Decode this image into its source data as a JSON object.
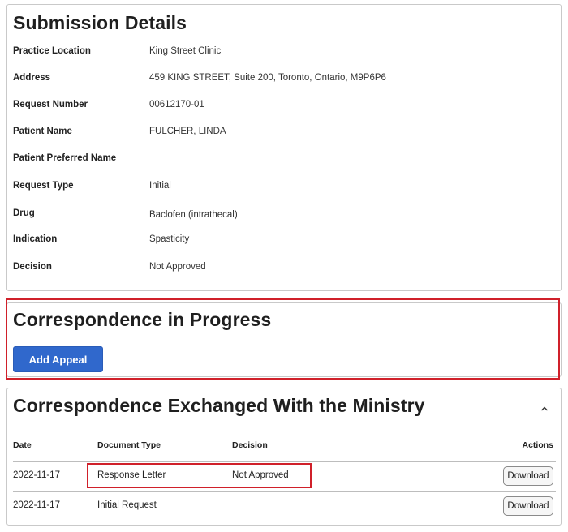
{
  "submission_details": {
    "title": "Submission Details",
    "rows": [
      {
        "label": "Practice Location",
        "value": "King Street Clinic"
      },
      {
        "label": "Address",
        "value": "459 KING STREET, Suite 200, Toronto, Ontario, M9P6P6"
      },
      {
        "label": "Request Number",
        "value": "00612170-01"
      },
      {
        "label": "Patient Name",
        "value": "FULCHER, LINDA"
      },
      {
        "label": "Patient Preferred Name",
        "value": ""
      },
      {
        "label": "Request Type",
        "value": "Initial"
      },
      {
        "label": "Drug",
        "value": "Baclofen (intrathecal)"
      },
      {
        "label": "Indication",
        "value": "Spasticity"
      },
      {
        "label": "Decision",
        "value": "Not Approved"
      }
    ]
  },
  "correspondence_in_progress": {
    "title": "Correspondence in Progress",
    "add_appeal_label": "Add Appeal"
  },
  "correspondence_exchanged": {
    "title": "Correspondence Exchanged With the Ministry",
    "collapse_icon": "chevron-up-icon",
    "columns": {
      "date": "Date",
      "document_type": "Document Type",
      "decision": "Decision",
      "actions": "Actions"
    },
    "rows": [
      {
        "date": "2022-11-17",
        "document_type": "Response Letter",
        "decision": "Not Approved",
        "action_label": "Download"
      },
      {
        "date": "2022-11-17",
        "document_type": "Initial Request",
        "decision": "",
        "action_label": "Download"
      }
    ]
  },
  "colors": {
    "primary_button": "#3068cc",
    "highlight": "#d0202a",
    "border": "#c9c9c9"
  }
}
